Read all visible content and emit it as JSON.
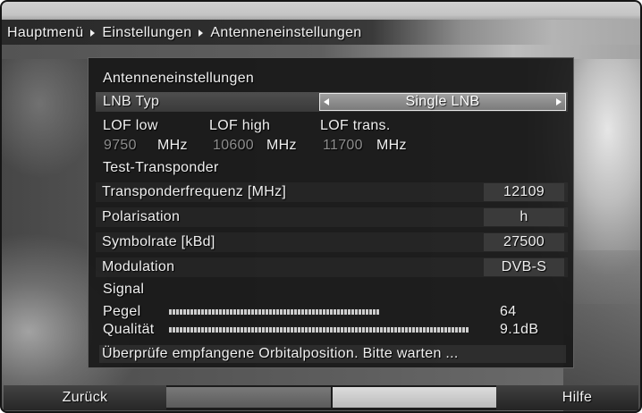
{
  "breadcrumb": {
    "items": [
      "Hauptmenü",
      "Einstellungen",
      "Antenneneinstellungen"
    ],
    "separator_icon": "chevron-right-icon"
  },
  "panel": {
    "title": "Antenneneinstellungen",
    "lnb": {
      "label": "LNB Typ",
      "value": "Single LNB",
      "prev_icon": "arrow-left-icon",
      "next_icon": "arrow-right-icon"
    },
    "lof": {
      "low": {
        "label": "LOF low",
        "value": "9750",
        "unit": "MHz"
      },
      "high": {
        "label": "LOF high",
        "value": "10600",
        "unit": "MHz"
      },
      "trans": {
        "label": "LOF trans.",
        "value": "11700",
        "unit": "MHz"
      }
    },
    "test_transponder": {
      "heading": "Test-Transponder",
      "rows": [
        {
          "label": "Transponderfrequenz [MHz]",
          "value": "12109"
        },
        {
          "label": "Polarisation",
          "value": "h"
        },
        {
          "label": "Symbolrate [kBd]",
          "value": "27500"
        },
        {
          "label": "Modulation",
          "value": "DVB-S"
        }
      ]
    },
    "signal": {
      "heading": "Signal",
      "pegel": {
        "label": "Pegel",
        "value": "64",
        "level": 0.64
      },
      "qualitaet": {
        "label": "Qualität",
        "value": "9.1dB",
        "level": 0.91
      }
    },
    "status": "Überprüfe empfangene Orbitalposition. Bitte warten ..."
  },
  "footer": {
    "buttons": [
      {
        "label": "Zurück",
        "color": "#2d2d2d"
      },
      {
        "color": "#6a6a6a"
      },
      {
        "color": "#d9d9d9"
      },
      {
        "label": "Hilfe",
        "color": "#2a2a2a"
      }
    ]
  }
}
